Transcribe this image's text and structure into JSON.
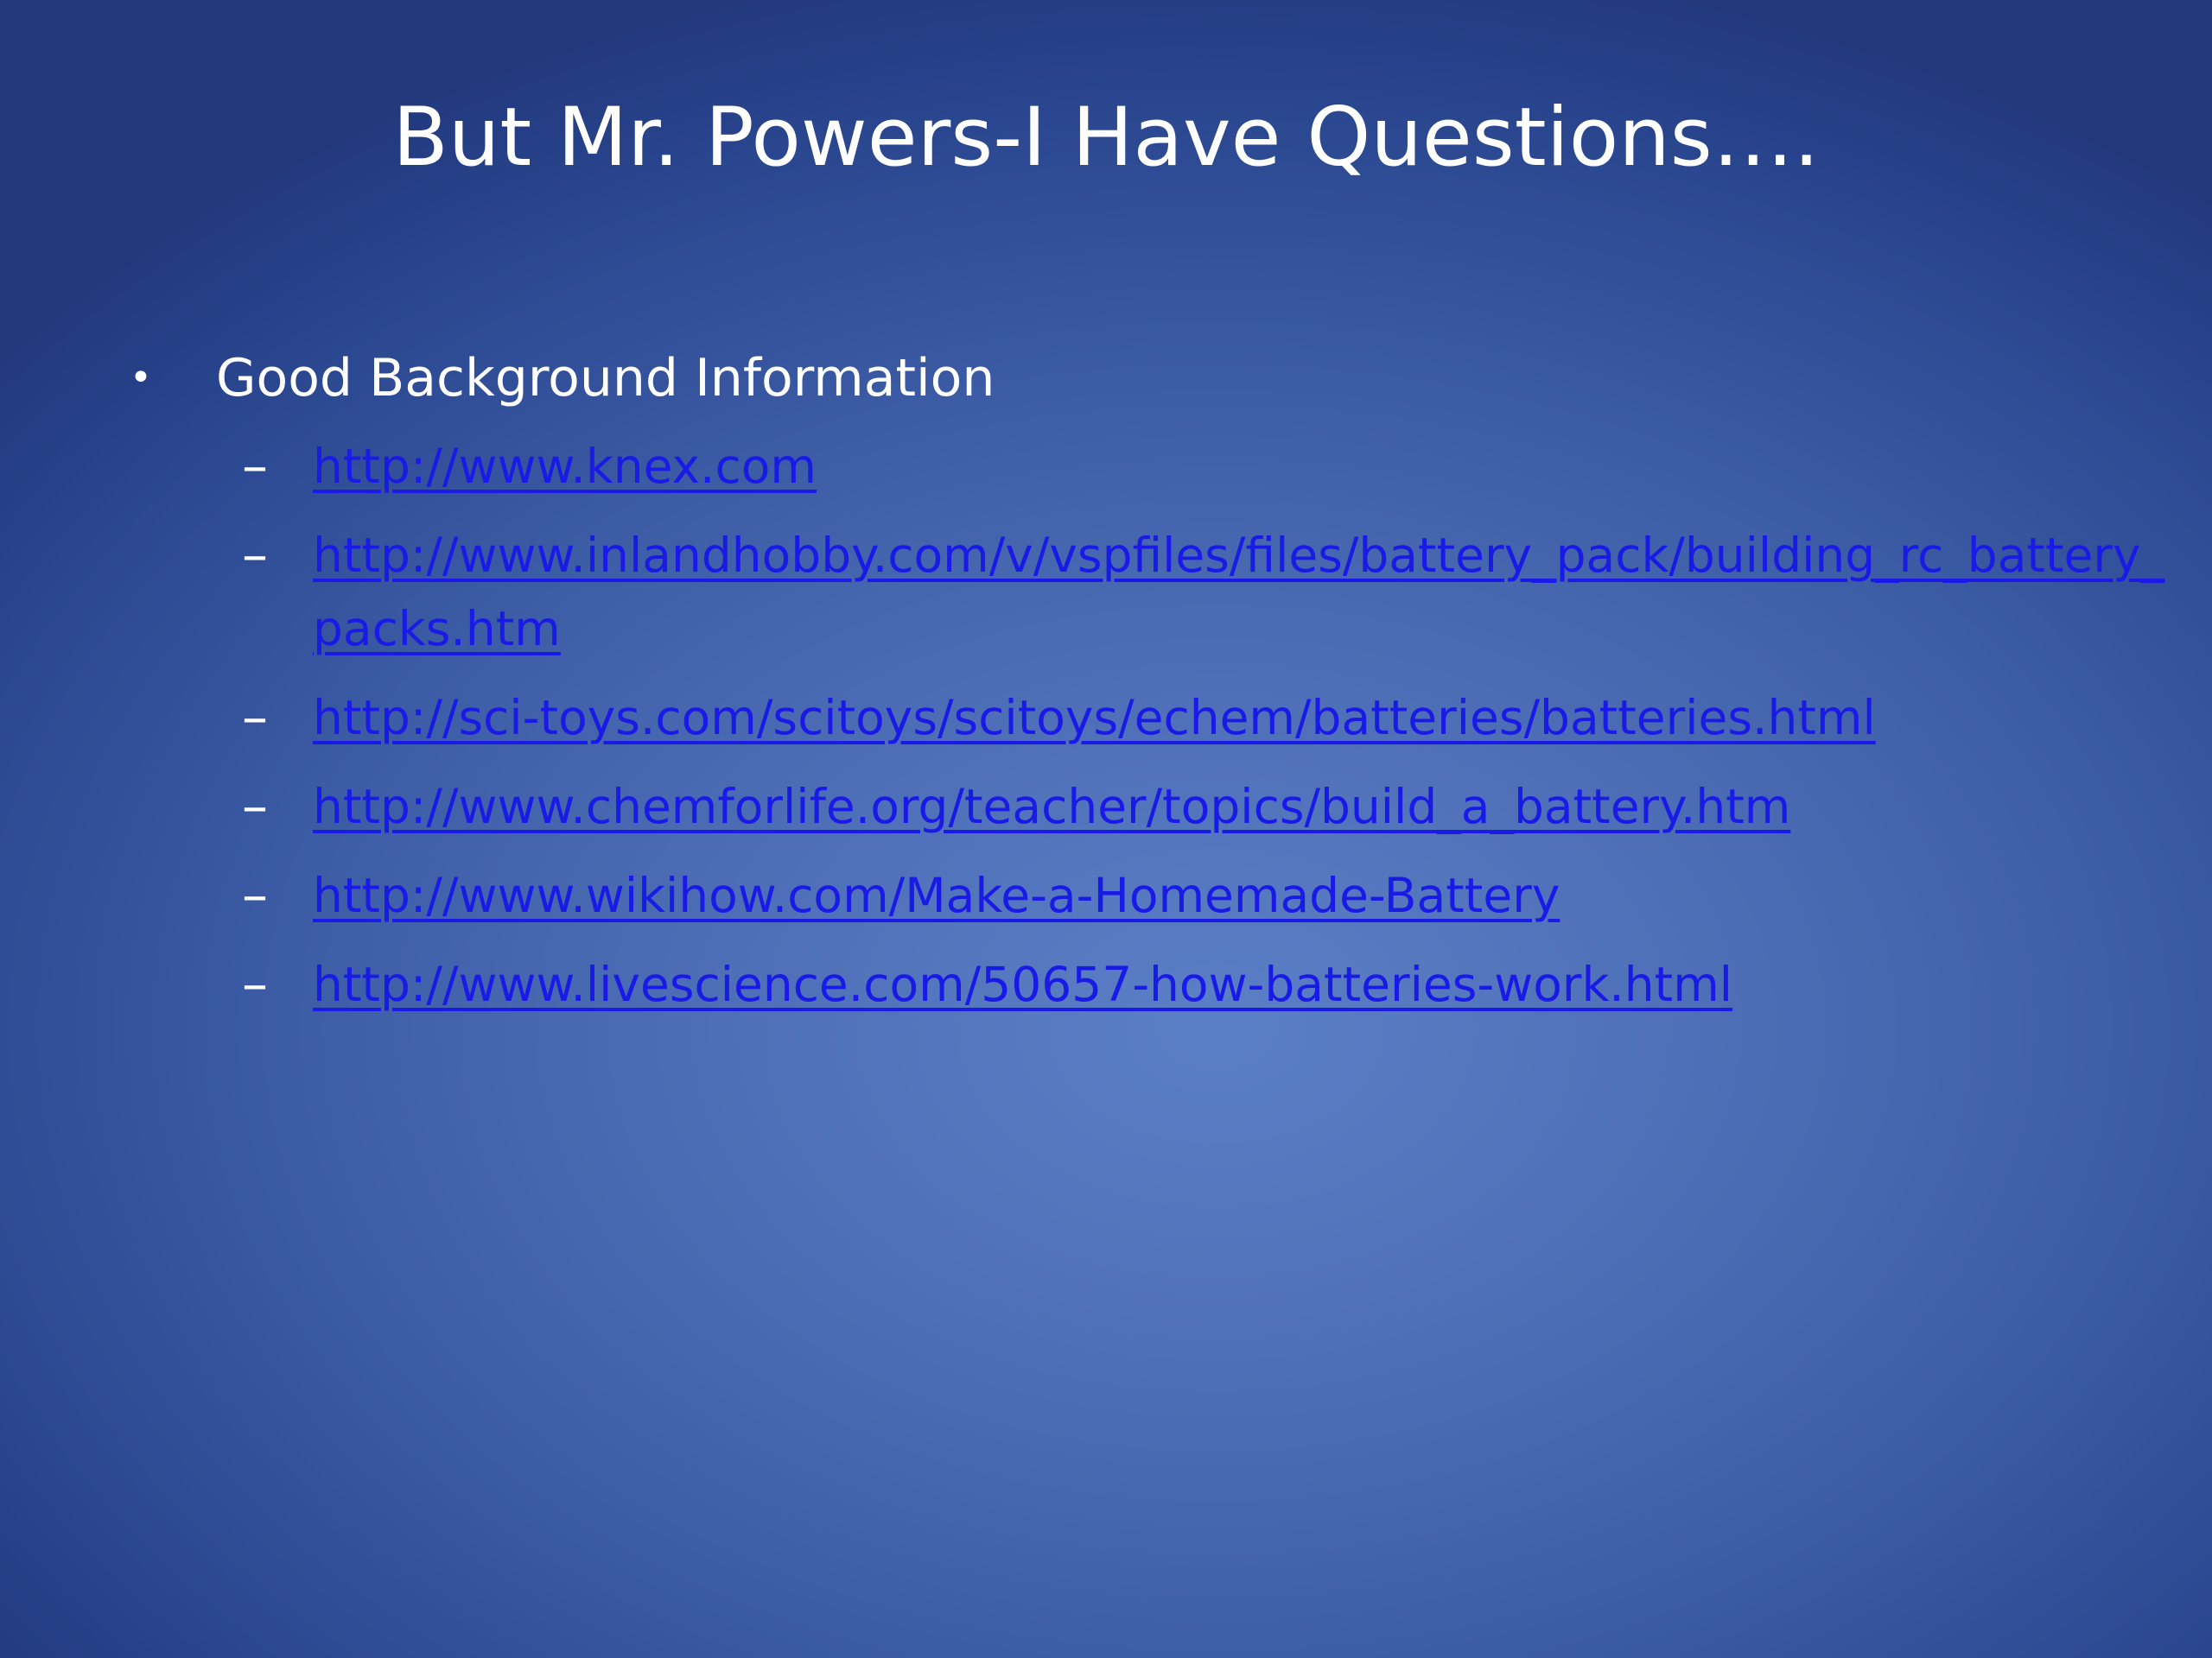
{
  "slide": {
    "title": "But Mr. Powers-I Have Questions….",
    "bullet": {
      "text": "Good Background Information"
    },
    "links": [
      "http://www.knex.com",
      "http://www.inlandhobby.com/v/vspfiles/files/battery_pack/building_rc_battery_packs.htm",
      "http://sci-toys.com/scitoys/scitoys/echem/batteries/batteries.html",
      "http://www.chemforlife.org/teacher/topics/build_a_battery.htm",
      "http://www.wikihow.com/Make-a-Homemade-Battery",
      "http://www.livescience.com/50657-how-batteries-work.html"
    ]
  },
  "colors": {
    "link": "#1a1ae6",
    "text": "#ffffff",
    "background": "#4f70b8"
  }
}
